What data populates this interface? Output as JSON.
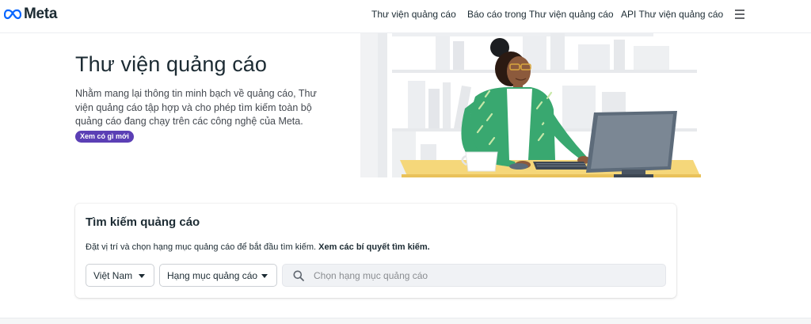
{
  "brand": {
    "name": "Meta",
    "color": "#0866ff"
  },
  "nav": {
    "links": [
      "Thư viện quảng cáo",
      "Báo cáo trong Thư viện quảng cáo",
      "API Thư viện quảng cáo"
    ],
    "menu_icon": "hamburger-menu-icon"
  },
  "hero": {
    "title": "Thư viện quảng cáo",
    "description": "Nhằm mang lại thông tin minh bạch về quảng cáo, Thư viện quảng cáo tập hợp và cho phép tìm kiếm toàn bộ quảng cáo đang chạy trên các công nghệ của Meta.",
    "badge": "Xem có gì mới",
    "badge_color": "#5b3fb5"
  },
  "search": {
    "title": "Tìm kiếm quảng cáo",
    "description": "Đặt vị trí và chọn hạng mục quảng cáo để bắt đầu tìm kiếm.",
    "tips_link": "Xem các bí quyết tìm kiếm.",
    "country": "Việt Nam",
    "category": "Hạng mục quảng cáo",
    "placeholder": "Chọn hạng mục quảng cáo",
    "search_icon": "search-icon"
  }
}
